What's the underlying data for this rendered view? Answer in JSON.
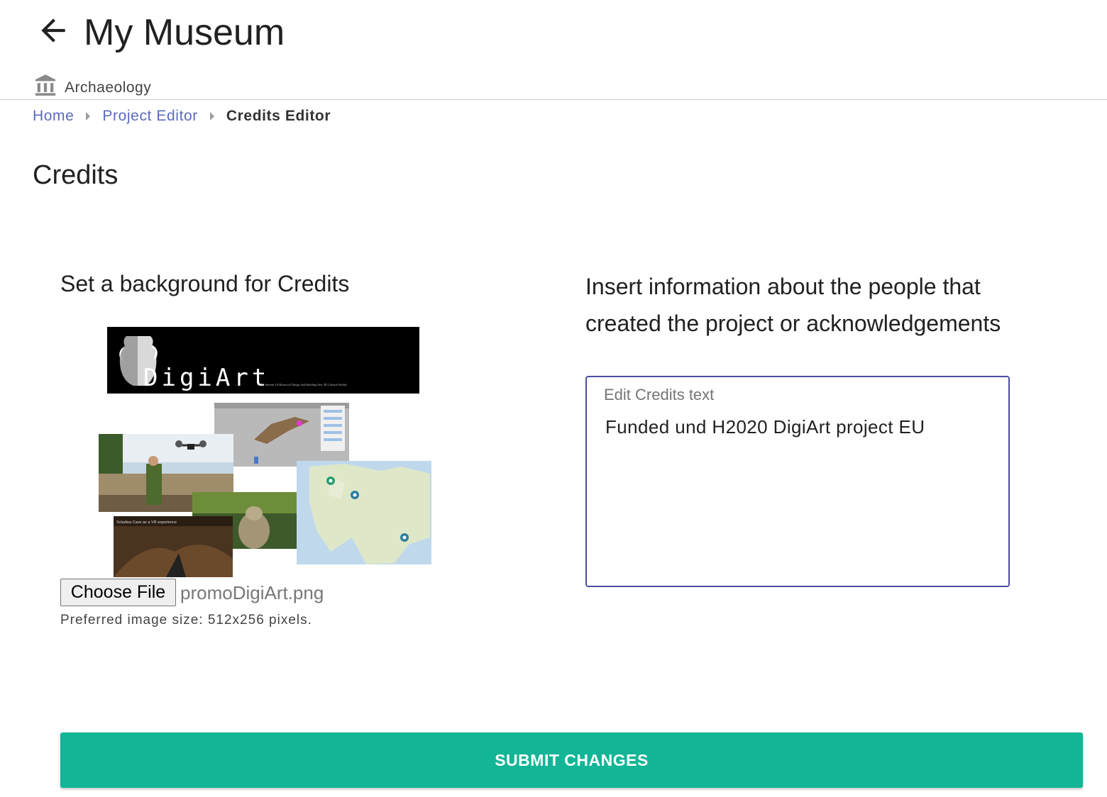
{
  "header": {
    "title": "My Museum",
    "category": "Archaeology",
    "back_icon": "arrow-left-icon",
    "category_icon": "museum-icon"
  },
  "breadcrumb": {
    "items": [
      "Home",
      "Project Editor"
    ],
    "current": "Credits Editor"
  },
  "page": {
    "heading": "Credits"
  },
  "background_section": {
    "heading": "Set a background for Credits",
    "preview_banner": "DigiArt",
    "preview_tagline": "The Internet Of Historical Things And Building New 3D Cultural Worlds",
    "preview_caption": "Scladina Cave as a VR experience",
    "file_button": "Choose File",
    "file_name": "promoDigiArt.png",
    "hint": "Preferred image size: 512x256 pixels."
  },
  "credits_section": {
    "heading": "Insert information about the people that created the project or acknowledgements",
    "textarea_label": "Edit Credits text",
    "textarea_value": "Funded und H2020 DigiArt project EU"
  },
  "submit": {
    "label": "SUBMIT CHANGES"
  },
  "colors": {
    "accent": "#12b595",
    "link": "#3f51b5",
    "field_border": "#4a4fa0"
  }
}
